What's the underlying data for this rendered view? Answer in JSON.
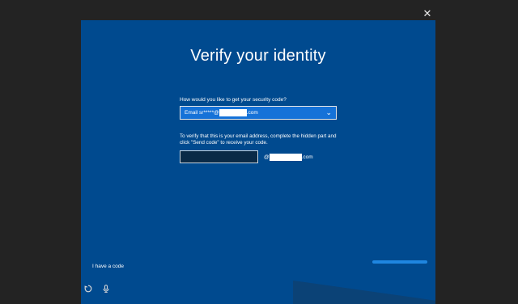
{
  "window": {
    "close_icon": "close-icon"
  },
  "dialog": {
    "title": "Verify your identity",
    "question_label": "How would you like to get your security code?",
    "method_select": {
      "prefix": "Email sr*****@",
      "suffix": ".com"
    },
    "instruction": "To verify that this is your email address, complete the hidden part and click \"Send code\" to receive your code.",
    "code_input": {
      "value": "",
      "placeholder": ""
    },
    "email_domain": {
      "prefix": "@",
      "suffix": ".com"
    },
    "have_code_link": "I have a code"
  },
  "toolbar": {
    "icons": [
      "ease-of-access-icon",
      "microphone-icon"
    ]
  },
  "colors": {
    "background": "#232323",
    "dialog": "#004a8f",
    "select": "#1572d8",
    "input": "#0a2a47",
    "accent": "#1f86e0"
  }
}
